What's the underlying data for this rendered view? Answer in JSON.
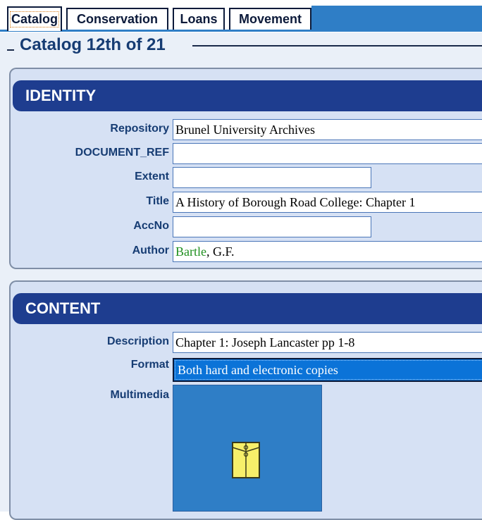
{
  "tabs": [
    {
      "label": "Catalog",
      "active": true
    },
    {
      "label": "Conservation",
      "active": false
    },
    {
      "label": "Loans",
      "active": false
    },
    {
      "label": "Movement",
      "active": false
    }
  ],
  "page": {
    "title": "Catalog 12th of 21"
  },
  "identity": {
    "header": "IDENTITY",
    "fields": {
      "repository": {
        "label": "Repository",
        "value": "Brunel University Archives"
      },
      "document_ref": {
        "label": "DOCUMENT_REF",
        "value": ""
      },
      "extent": {
        "label": "Extent",
        "value": ""
      },
      "title": {
        "label": "Title",
        "value": "A History of Borough Road College: Chapter 1"
      },
      "accno": {
        "label": "AccNo",
        "value": ""
      },
      "author": {
        "label": "Author",
        "value_link": "Bartle",
        "value_rest": ", G.F."
      }
    }
  },
  "content": {
    "header": "CONTENT",
    "fields": {
      "description": {
        "label": "Description",
        "value": "Chapter 1: Joseph Lancaster pp 1-8"
      },
      "format": {
        "label": "Format",
        "value": "Both hard and electronic copies"
      },
      "multimedia": {
        "label": "Multimedia",
        "icon": "envelope-icon"
      }
    }
  },
  "colors": {
    "section_header": "#1e3d8f",
    "label_text": "#163c73",
    "selected_option": "#0b73d8",
    "tab_strip": "#2f7ec6",
    "author_link": "#1f8f1f"
  }
}
